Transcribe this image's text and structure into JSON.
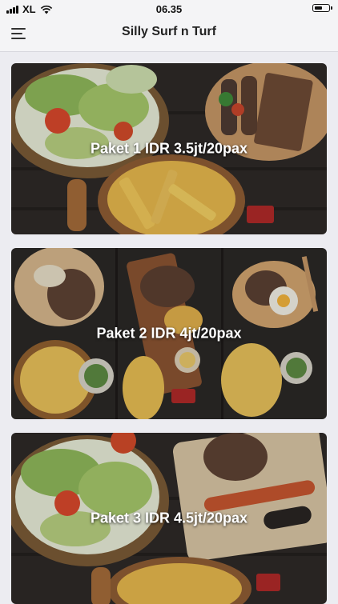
{
  "status_bar": {
    "carrier": "XL",
    "time": "06.35",
    "battery_level": 0.6,
    "icons": [
      "signal-icon",
      "wifi-icon",
      "battery-icon"
    ]
  },
  "nav": {
    "title": "Silly Surf n Turf",
    "menu_icon": "hamburger-menu-icon"
  },
  "packages": [
    {
      "label": "Paket 1 IDR 3.5jt/20pax"
    },
    {
      "label": "Paket 2 IDR 4jt/20pax"
    },
    {
      "label": "Paket 3 IDR 4.5jt/20pax"
    }
  ],
  "colors": {
    "nav_background": "#f4f4f6",
    "page_background": "#ececf1",
    "card_label": "#ffffff"
  }
}
